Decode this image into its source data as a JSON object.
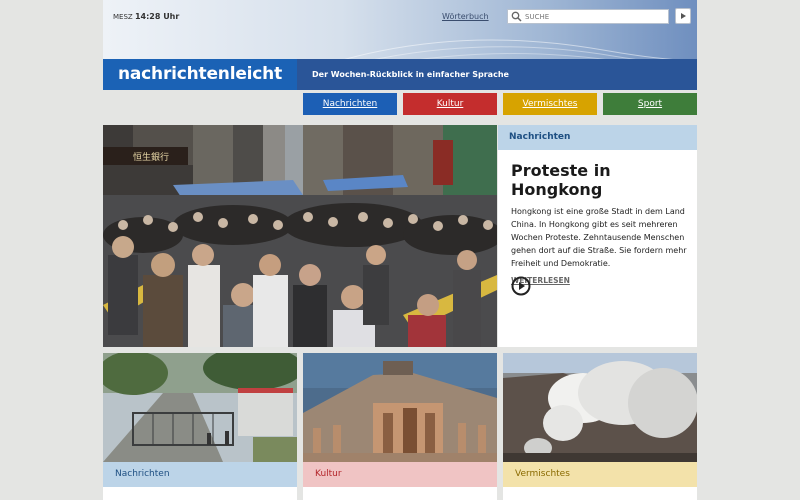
{
  "header": {
    "timezone": "MESZ",
    "time": "14:28 Uhr",
    "dictionary_link": "Wörterbuch",
    "search_placeholder": "SUCHE",
    "logo": "nachrichtenleicht",
    "tagline": "Der Wochen-Rückblick in einfacher Sprache"
  },
  "nav": [
    {
      "label": "Nachrichten",
      "color": "#1c5fb5"
    },
    {
      "label": "Kultur",
      "color": "#c42d2d"
    },
    {
      "label": "Vermischtes",
      "color": "#d7a300"
    },
    {
      "label": "Sport",
      "color": "#3e7d3a"
    }
  ],
  "hero": {
    "category": "Nachrichten",
    "title": "Proteste in Hongkong",
    "text": "Hongkong ist eine große Stadt in dem Land China. In Hongkong gibt es seit mehreren Wochen Proteste. Zehntausende Menschen gehen dort auf die Straße. Sie fordern mehr Freiheit und Demokratie.",
    "more": "WEITERLESEN",
    "sign_text": "恒生銀行"
  },
  "cards": [
    {
      "category": "Nachrichten",
      "bg": "#bcd4e8",
      "fg": "#1e4f82"
    },
    {
      "category": "Kultur",
      "bg": "#f0c4c4",
      "fg": "#b3262b"
    },
    {
      "category": "Vermischtes",
      "bg": "#f3e2aa",
      "fg": "#8a6a00"
    }
  ]
}
